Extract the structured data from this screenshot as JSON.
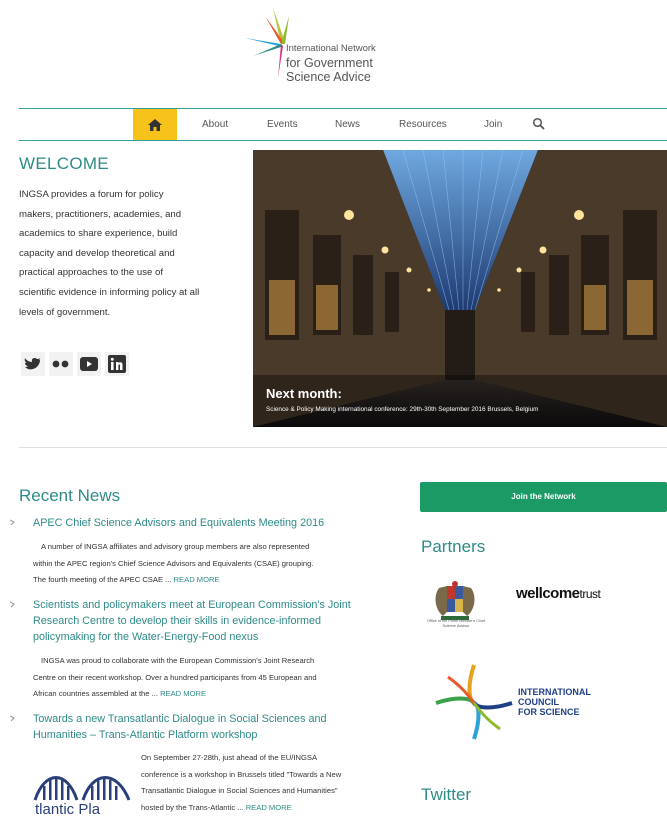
{
  "logo": {
    "line1": "International Network",
    "line2": "for Government",
    "line3": "Science Advice"
  },
  "nav": {
    "items": [
      {
        "label": "About"
      },
      {
        "label": "Events"
      },
      {
        "label": "News"
      },
      {
        "label": "Resources"
      },
      {
        "label": "Join"
      }
    ],
    "home_icon": "home-icon",
    "search_icon": "search-icon",
    "accent": "#f7c21a"
  },
  "welcome": {
    "title": "WELCOME",
    "lines": [
      "INGSA provides a forum for policy",
      "makers, practitioners, academies, and",
      "academics to share experience, build",
      "capacity and develop theoretical and",
      "practical approaches to the use of",
      "scientific evidence in informing policy at all",
      "levels of government."
    ]
  },
  "social": [
    "twitter-icon",
    "flickr-icon",
    "youtube-icon",
    "linkedin-icon"
  ],
  "hero": {
    "caption_title": "Next month:",
    "caption_sub": "Science & Policy Making international conference: 29th-30th September 2016 Brussels, Belgium"
  },
  "news": {
    "title": "Recent News",
    "items": [
      {
        "headline_lines": [
          "APEC Chief Science Advisors and Equivalents Meeting 2016"
        ],
        "body_lines": [
          "A number of INGSA affiliates and advisory group members are also represented",
          "within the APEC region's Chief Science Advisors and Equivalents (CSAE) grouping.",
          "The fourth meeting of the APEC CSAE ..."
        ],
        "read_more": "READ MORE"
      },
      {
        "headline_lines": [
          "Scientists and policymakers meet at European Commission's Joint",
          "Research Centre to develop their skills in evidence-informed",
          "policymaking for the Water-Energy-Food nexus"
        ],
        "body_lines": [
          "INGSA was proud to collaborate with the European Commission's Joint Research",
          "Centre on their recent workshop. Over a hundred participants from 45 European and",
          "African countries assembled at the ..."
        ],
        "read_more": "READ MORE"
      },
      {
        "headline_lines": [
          "Towards a new Transatlantic Dialogue in Social Sciences and",
          "Humanities – Trans-Atlantic Platform workshop"
        ],
        "body_lines": [
          "On September 27-28th, just ahead of the EU/INGSA",
          "conference is a workshop in Brussels titled \"Towards a New",
          "Transatlantic Dialogue in Social Sciences and Humanities\"",
          "hosted by the Trans-Atlantic ..."
        ],
        "read_more": "READ MORE",
        "thumb_text": "tlantic Pla"
      }
    ]
  },
  "sidebar": {
    "join_label": "Join the Network",
    "join_color": "#1b9a66",
    "partners_title": "Partners",
    "crest_caption": "Office of the Prime Minister's Chief Science Advisor",
    "wellcome_main": "wellcome",
    "wellcome_suffix": "trust",
    "icsu_lines": [
      "INTERNATIONAL",
      "COUNCIL",
      "FOR SCIENCE"
    ],
    "twitter_title": "Twitter"
  }
}
